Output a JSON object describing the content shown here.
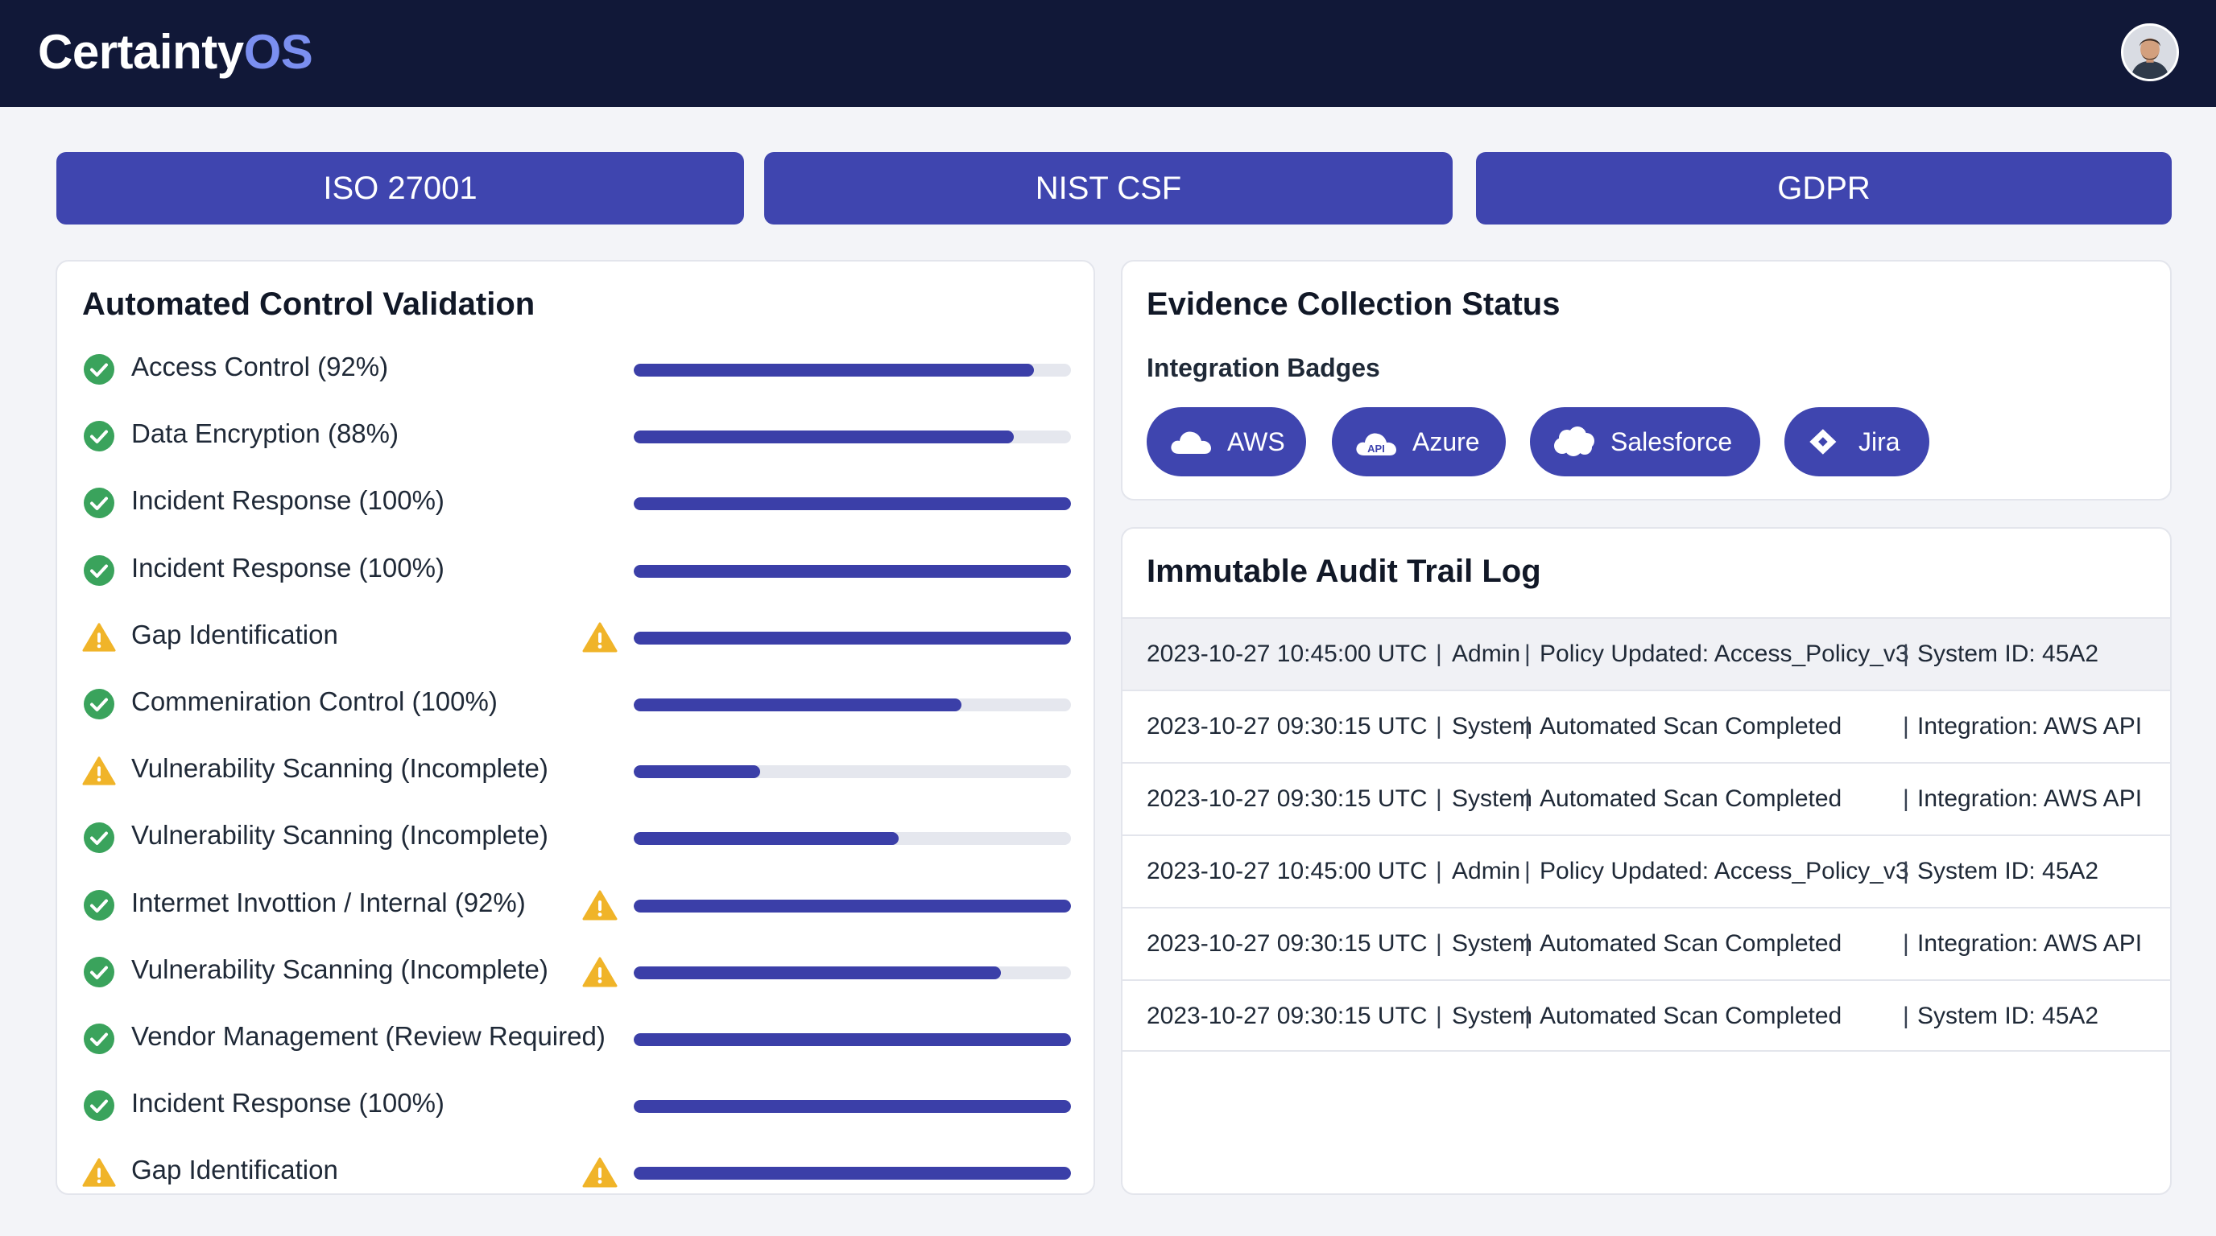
{
  "app": {
    "brand_main": "Certainty",
    "brand_accent": "OS",
    "avatar_icon": "user-avatar"
  },
  "frameworks": [
    {
      "label": "ISO 27001"
    },
    {
      "label": "NIST CSF"
    },
    {
      "label": "GDPR"
    }
  ],
  "controls": {
    "title": "Automated Control Validation",
    "items": [
      {
        "label": "Access Control (92%)",
        "status": "pass",
        "warning": false,
        "progress": 0.915
      },
      {
        "label": "Data Encryption (88%)",
        "status": "pass",
        "warning": false,
        "progress": 0.87
      },
      {
        "label": "Incident Response (100%)",
        "status": "pass",
        "warning": false,
        "progress": 1.0
      },
      {
        "label": "Incident Response (100%)",
        "status": "pass",
        "warning": false,
        "progress": 1.0
      },
      {
        "label": "Gap Identification",
        "status": "warn",
        "warning": true,
        "progress": 1.0
      },
      {
        "label": "Commeniration Control (100%)",
        "status": "pass",
        "warning": false,
        "progress": 0.75
      },
      {
        "label": "Vulnerability Scanning (Incomplete)",
        "status": "warn",
        "warning": false,
        "progress": 0.29
      },
      {
        "label": "Vulnerability Scanning (Incomplete)",
        "status": "pass",
        "warning": false,
        "progress": 0.605
      },
      {
        "label": "Intermet Invottion / Internal (92%)",
        "status": "pass",
        "warning": true,
        "progress": 1.0
      },
      {
        "label": "Vulnerability Scanning (Incomplete)",
        "status": "pass",
        "warning": true,
        "progress": 0.84
      },
      {
        "label": "Vendor Management (Review Required)",
        "status": "pass",
        "warning": false,
        "progress": 1.0
      },
      {
        "label": "Incident Response (100%)",
        "status": "pass",
        "warning": false,
        "progress": 1.0
      },
      {
        "label": "Gap Identification",
        "status": "warn",
        "warning": true,
        "progress": 1.0
      }
    ]
  },
  "evidence": {
    "title": "Evidence Collection Status",
    "subtitle": "Integration Badges",
    "badges": [
      {
        "label": "AWS",
        "icon": "cloud-icon"
      },
      {
        "label": "Azure",
        "icon": "api-cloud-icon"
      },
      {
        "label": "Salesforce",
        "icon": "salesforce-cloud-icon"
      },
      {
        "label": "Jira",
        "icon": "jira-icon"
      }
    ]
  },
  "audit": {
    "title": "Immutable Audit Trail Log",
    "separator": "|",
    "entries": [
      {
        "timestamp": "2023-10-27 10:45:00 UTC",
        "actor": "Admin",
        "event": "Policy Updated: Access_Policy_v3",
        "ref": "System ID: 45A2"
      },
      {
        "timestamp": "2023-10-27 09:30:15 UTC",
        "actor": "System",
        "event": "Automated Scan Completed",
        "ref": "Integration: AWS API"
      },
      {
        "timestamp": "2023-10-27 09:30:15 UTC",
        "actor": "System",
        "event": "Automated Scan Completed",
        "ref": "Integration: AWS API"
      },
      {
        "timestamp": "2023-10-27 10:45:00 UTC",
        "actor": "Admin",
        "event": "Policy Updated: Access_Policy_v3",
        "ref": "System ID: 45A2"
      },
      {
        "timestamp": "2023-10-27 09:30:15 UTC",
        "actor": "System",
        "event": "Automated Scan Completed",
        "ref": "Integration: AWS API"
      },
      {
        "timestamp": "2023-10-27 09:30:15 UTC",
        "actor": "System",
        "event": "Automated Scan Completed",
        "ref": "System ID: 45A2"
      }
    ]
  },
  "colors": {
    "topbar": "#111838",
    "brand_accent": "#7b8ff0",
    "primary": "#3f45af",
    "bar_fill": "#3b3fa8",
    "bar_track": "#e5e7ee",
    "pass": "#3aa35c",
    "warn": "#f0b429"
  }
}
